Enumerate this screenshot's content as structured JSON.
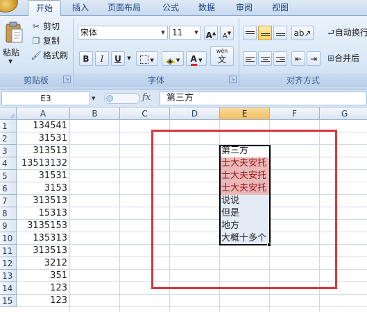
{
  "ribbon_tabs": [
    "开始",
    "插入",
    "页面布局",
    "公式",
    "数据",
    "审阅",
    "视图"
  ],
  "clipboard": {
    "paste": "粘贴",
    "cut": "剪切",
    "copy": "复制",
    "format_painter": "格式刷",
    "title": "剪贴板"
  },
  "font": {
    "name": "宋体",
    "size": "11",
    "bold": "B",
    "italic": "I",
    "underline": "U",
    "font_color_glyph": "A",
    "phonetic_glyph": "wén",
    "phonetic_char": "文",
    "title": "字体",
    "grow": "A",
    "shrink": "A"
  },
  "alignment": {
    "title": "对齐方式",
    "wrap_text": "自动换行",
    "merge": "合并后"
  },
  "formula_bar": {
    "name_box": "E3",
    "fx": "fx",
    "formula": "第三方"
  },
  "columns": [
    "A",
    "B",
    "C",
    "D",
    "E",
    "F",
    "G"
  ],
  "selected_column": "E",
  "rows": [
    "1",
    "2",
    "3",
    "4",
    "5",
    "6",
    "7",
    "8",
    "9",
    "10",
    "11",
    "12",
    "13",
    "14",
    "15"
  ],
  "column_a": [
    "134541",
    "31531",
    "313513",
    "13513132",
    "31531",
    "3153",
    "313513",
    "15313",
    "3135153",
    "135313",
    "313513",
    "3212",
    "351",
    "123",
    "123"
  ],
  "column_e": [
    "第三方",
    "士大夫安托",
    "士大夫安托",
    "士大夫安托",
    "说说",
    "但是",
    "地方",
    "大概十多个"
  ],
  "colors": {
    "highlight_fill": "#e9b8b8",
    "highlight_text": "#9c1010",
    "annotation_box": "#d9363e"
  }
}
